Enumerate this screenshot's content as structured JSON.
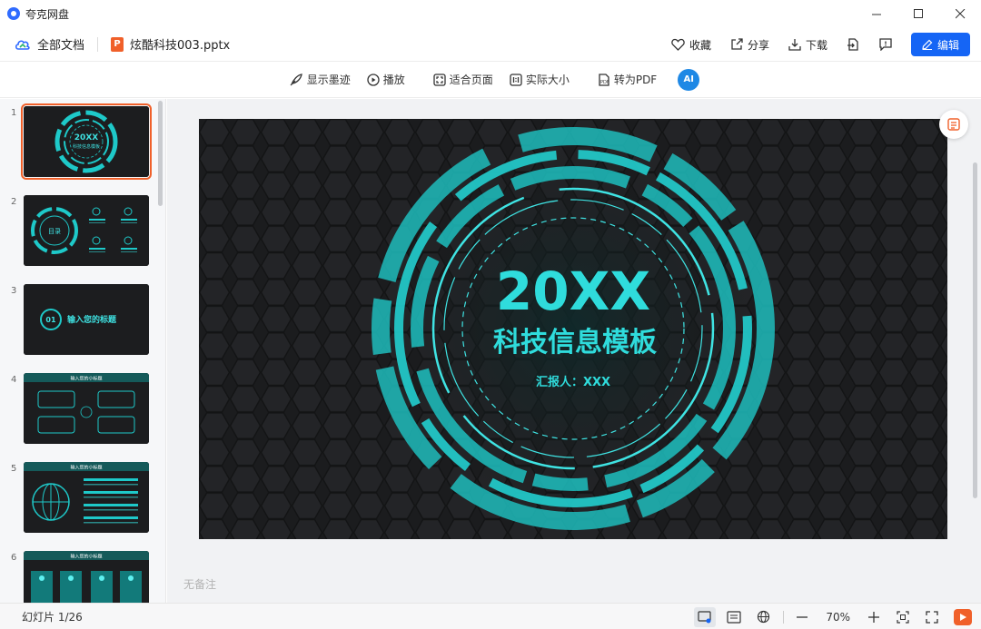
{
  "window": {
    "title": "夸克网盘"
  },
  "header": {
    "all_docs": "全部文档",
    "file_name": "炫酷科技003.pptx",
    "ppt_badge": "P",
    "favorite": "收藏",
    "share": "分享",
    "download": "下载",
    "edit": "编辑"
  },
  "toolbar": {
    "ink": "显示墨迹",
    "play": "播放",
    "fit_page": "适合页面",
    "actual_size": "实际大小",
    "to_pdf": "转为PDF",
    "ai": "AI"
  },
  "slide": {
    "year": "20XX",
    "subtitle": "科技信息模板",
    "reporter": "汇报人：XXX",
    "accent_color": "#1ec9c9"
  },
  "thumbnails": [
    {
      "num": "1",
      "title": "20XX",
      "subtitle": "科技信息模板",
      "selected": true
    },
    {
      "num": "2",
      "title": "目录",
      "selected": false
    },
    {
      "num": "3",
      "chapter": "01",
      "title": "输入您的标题",
      "selected": false
    },
    {
      "num": "4",
      "title": "输入您的小标题",
      "selected": false
    },
    {
      "num": "5",
      "title": "输入您的小标题",
      "selected": false
    },
    {
      "num": "6",
      "title": "输入您的小标题",
      "selected": false
    }
  ],
  "notes": "无备注",
  "status": {
    "slide_count": "幻灯片 1/26",
    "zoom": "70%"
  }
}
